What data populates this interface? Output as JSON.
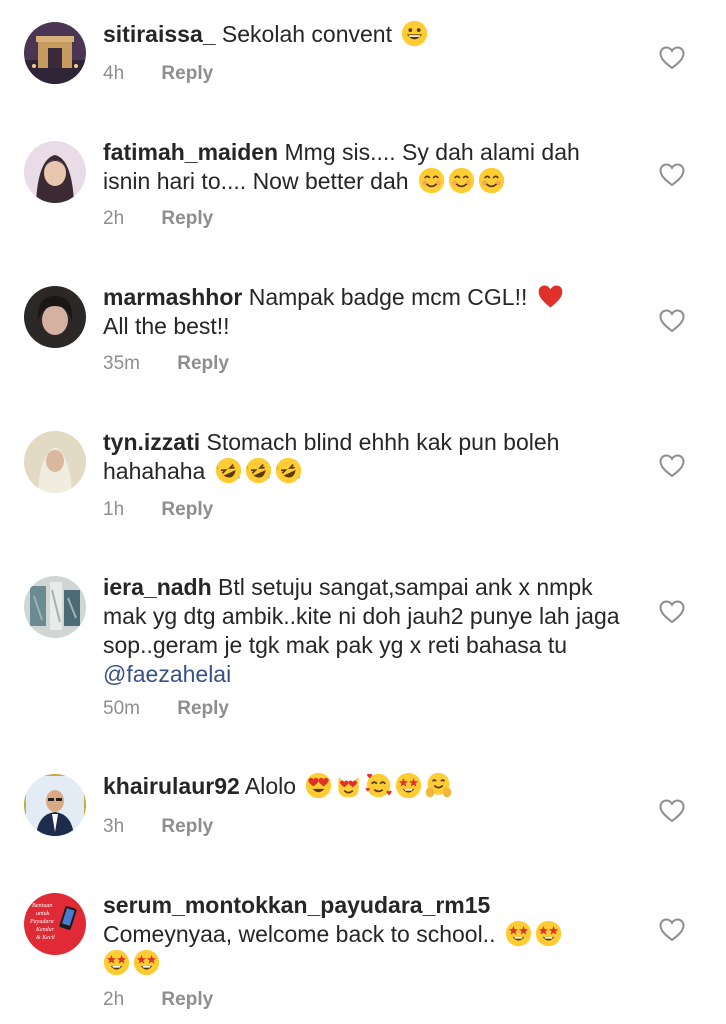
{
  "comments": [
    {
      "username": "sitiraissa_",
      "text": "Sekolah convent",
      "emojis": [
        "grinning-face-emoji"
      ],
      "time": "4h",
      "reply": "Reply",
      "avatar_colors": [
        "#5b3b5e",
        "#c9a06a"
      ]
    },
    {
      "username": "fatimah_maiden",
      "text": "Mmg sis.... Sy dah alami dah isnin hari to.... Now better dah",
      "emojis": [
        "smiling-face-emoji",
        "smiling-face-emoji",
        "smiling-face-emoji"
      ],
      "time": "2h",
      "reply": "Reply",
      "avatar_colors": [
        "#e9d7e4",
        "#3a2a30"
      ]
    },
    {
      "username": "marmashhor",
      "text": "Nampak badge mcm CGL!!",
      "text_after": "All the best!!",
      "emojis": [
        "red-heart-emoji"
      ],
      "time": "35m",
      "reply": "Reply",
      "avatar_colors": [
        "#2d2a29",
        "#c8a99a"
      ]
    },
    {
      "username": "tyn.izzati",
      "text": "Stomach blind ehhh kak pun boleh hahahaha",
      "emojis": [
        "rolling-laughing-emoji",
        "rolling-laughing-emoji",
        "rolling-laughing-emoji"
      ],
      "time": "1h",
      "reply": "Reply",
      "avatar_colors": [
        "#e6dcc6",
        "#b6a98c"
      ]
    },
    {
      "username": "iera_nadh",
      "text": "Btl setuju sangat,sampai ank x nmpk mak yg dtg ambik..kite ni doh jauh2 punye lah jaga sop..geram je tgk mak pak yg x reti bahasa tu",
      "mention": "@faezahelai",
      "emojis": [],
      "time": "50m",
      "reply": "Reply",
      "avatar_colors": [
        "#cfd6d4",
        "#5e7d86"
      ]
    },
    {
      "username": "khairulaur92",
      "text": "Alolo",
      "emojis": [
        "heart-eyes-emoji",
        "heart-eyes-cat-emoji",
        "smiling-hearts-emoji",
        "star-struck-emoji",
        "hugging-face-emoji"
      ],
      "time": "3h",
      "reply": "Reply",
      "avatar_colors": [
        "#dfe9f2",
        "#1d2c4d"
      ]
    },
    {
      "username": "serum_montokkan_payudara_rm15",
      "text": "Comeynyaa, welcome back to school..",
      "emojis": [
        "star-struck-emoji",
        "star-struck-emoji",
        "star-struck-emoji",
        "star-struck-emoji"
      ],
      "time": "2h",
      "reply": "Reply",
      "avatar_colors": [
        "#e02a36",
        "#ffffff"
      ],
      "avatar_text": [
        "Bantuan",
        "untuk",
        "Payudara",
        "Kendur",
        "& Kecil"
      ]
    }
  ],
  "icons": {
    "like": "heart-outline-icon"
  },
  "colors": {
    "text": "#262626",
    "meta": "#8e8e8e",
    "mention": "#385185"
  }
}
